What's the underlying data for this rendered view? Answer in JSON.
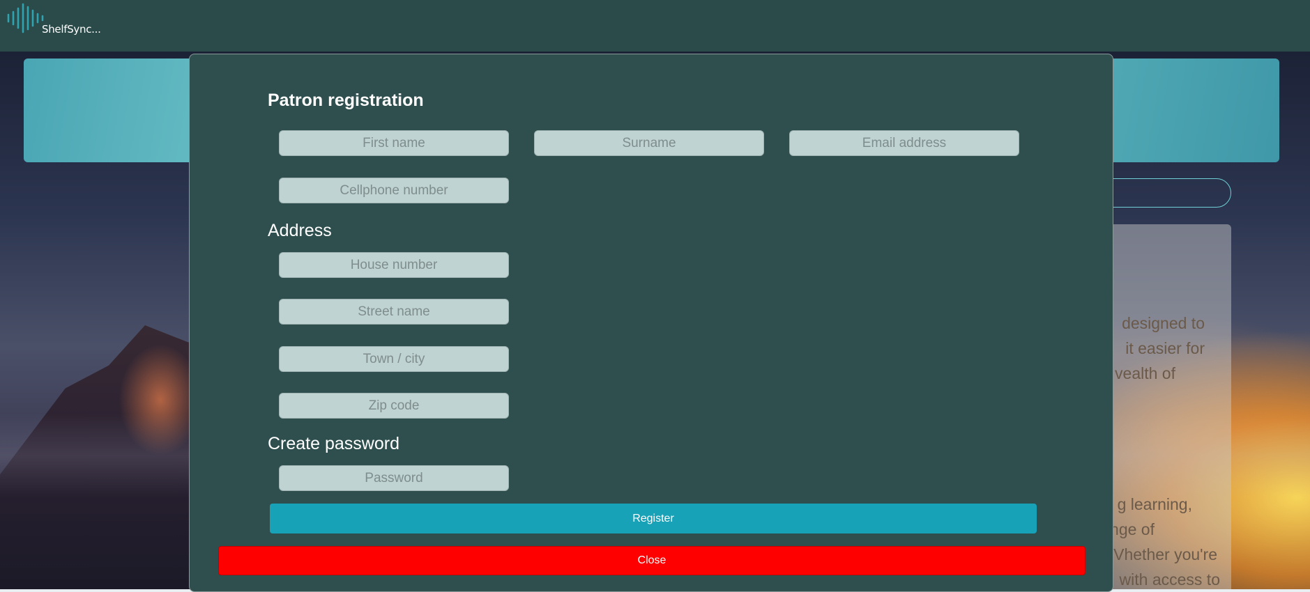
{
  "navbar": {
    "brand": "ShelfSync...",
    "logo_icon": "sound-wave-logo-icon",
    "background": "#2b4a4a",
    "accent": "#2fa3b0"
  },
  "background_page": {
    "about_lines": [
      "designed to",
      "it easier for",
      "vealth of",
      "g learning,",
      "ange of",
      "Vhether you're",
      "with access to"
    ]
  },
  "modal": {
    "title": "Patron registration",
    "fields": {
      "first_name_placeholder": "First name",
      "surname_placeholder": "Surname",
      "email_placeholder": "Email address",
      "cellphone_placeholder": "Cellphone number"
    },
    "address": {
      "title": "Address",
      "house_number_placeholder": "House number",
      "street_name_placeholder": "Street name",
      "town_city_placeholder": "Town / city",
      "zip_code_placeholder": "Zip code"
    },
    "password": {
      "title": "Create password",
      "password_placeholder": "Password"
    },
    "register_label": "Register",
    "close_label": "Close",
    "colors": {
      "modal_bg": "#2f4f4f",
      "field_bg": "#bfd3d2",
      "register_bg": "#17a2b8",
      "close_bg": "#ff0000"
    }
  }
}
